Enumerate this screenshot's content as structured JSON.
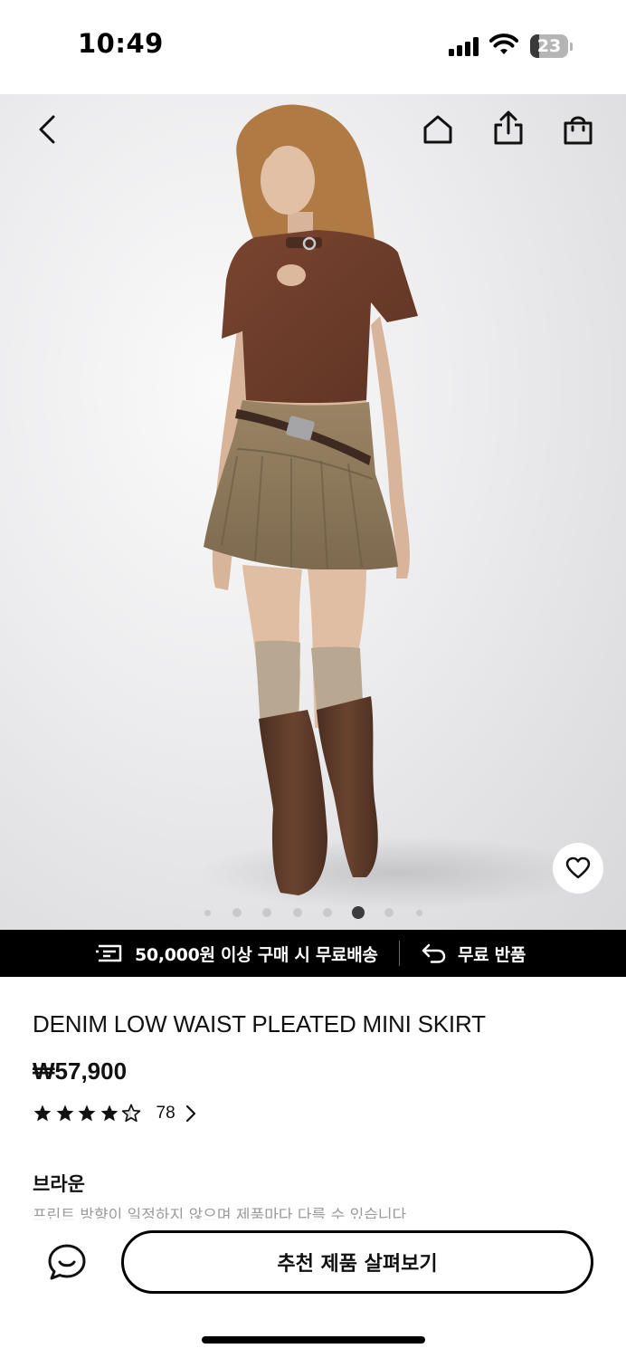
{
  "status_bar": {
    "time": "10:49",
    "battery_level": "23",
    "battery_fraction": 0.23
  },
  "header": {
    "icons": [
      "chevron-left-icon",
      "home-icon",
      "share-icon",
      "shopping-bag-icon"
    ]
  },
  "gallery": {
    "image_alt": "product-photo",
    "dot_count": 8,
    "active_index": 5,
    "wishlist_icon": "heart-icon"
  },
  "benefits": {
    "shipping": {
      "icon": "delivery-truck-icon",
      "text": "50,000원 이상 구매 시 무료배송"
    },
    "returns": {
      "icon": "return-arrow-icon",
      "text": "무료 반품"
    }
  },
  "product": {
    "name": "DENIM LOW WAIST PLEATED MINI SKIRT",
    "price": "₩57,900",
    "rating": 4.5,
    "review_count": "78",
    "color_name": "브라운",
    "note": "프린트 방향이 일정하지 않으며 제품마다 다를 수 있습니다"
  },
  "bottom_bar": {
    "chat_icon": "chat-bubble-icon",
    "recommend_label": "추천 제품 살펴보기"
  },
  "colors": {
    "accent": "#000000",
    "background": "#ffffff",
    "muted_text": "#9a9a9a"
  }
}
